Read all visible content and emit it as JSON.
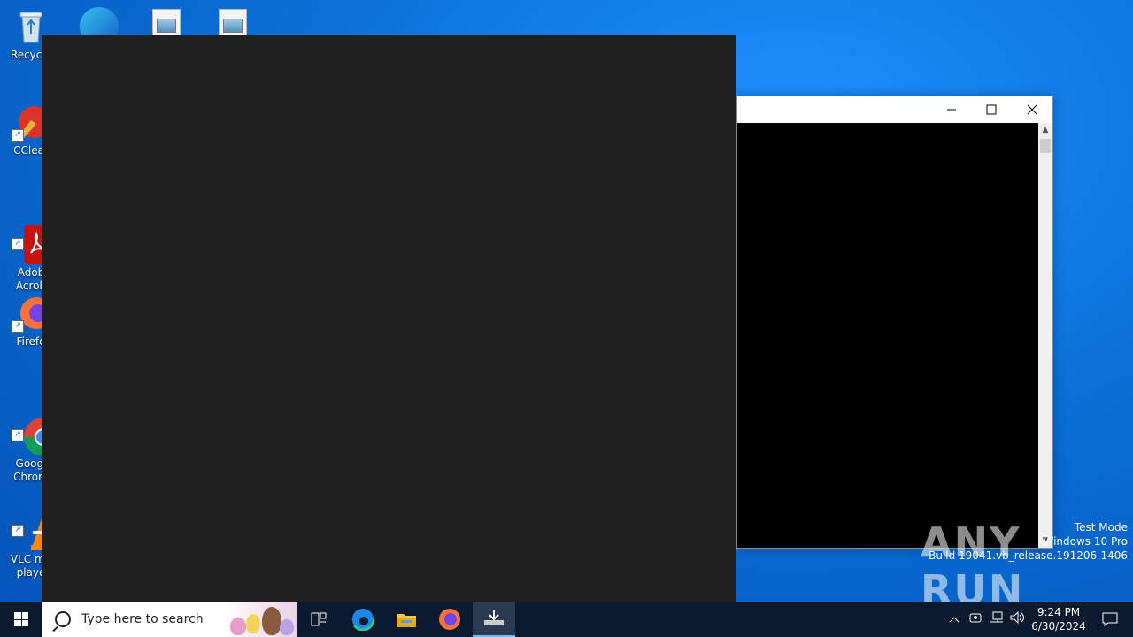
{
  "desktop": {
    "icons": [
      {
        "name": "recycle-bin",
        "label": "Recycle"
      },
      {
        "name": "ccleaner",
        "label": "CClear"
      },
      {
        "name": "adobe-acrobat",
        "label": "Adob\nAcrob"
      },
      {
        "name": "firefox",
        "label": "Firefo"
      },
      {
        "name": "google-chrome",
        "label": "Googl\nChrom"
      },
      {
        "name": "vlc-media-player",
        "label": "VLC me\nplaye"
      }
    ]
  },
  "watermark": {
    "logo": "ANY RUN",
    "mode": "Test Mode",
    "os": "Windows 10 Pro",
    "build": "Build 19041.vb_release.191206-1406"
  },
  "taskbar": {
    "search_placeholder": "Type here to search",
    "time": "9:24 PM",
    "date": "6/30/2024"
  },
  "colors": {
    "taskbar": "#0b1a2e",
    "dark_window": "#202020",
    "accent": "#76b9ed"
  }
}
